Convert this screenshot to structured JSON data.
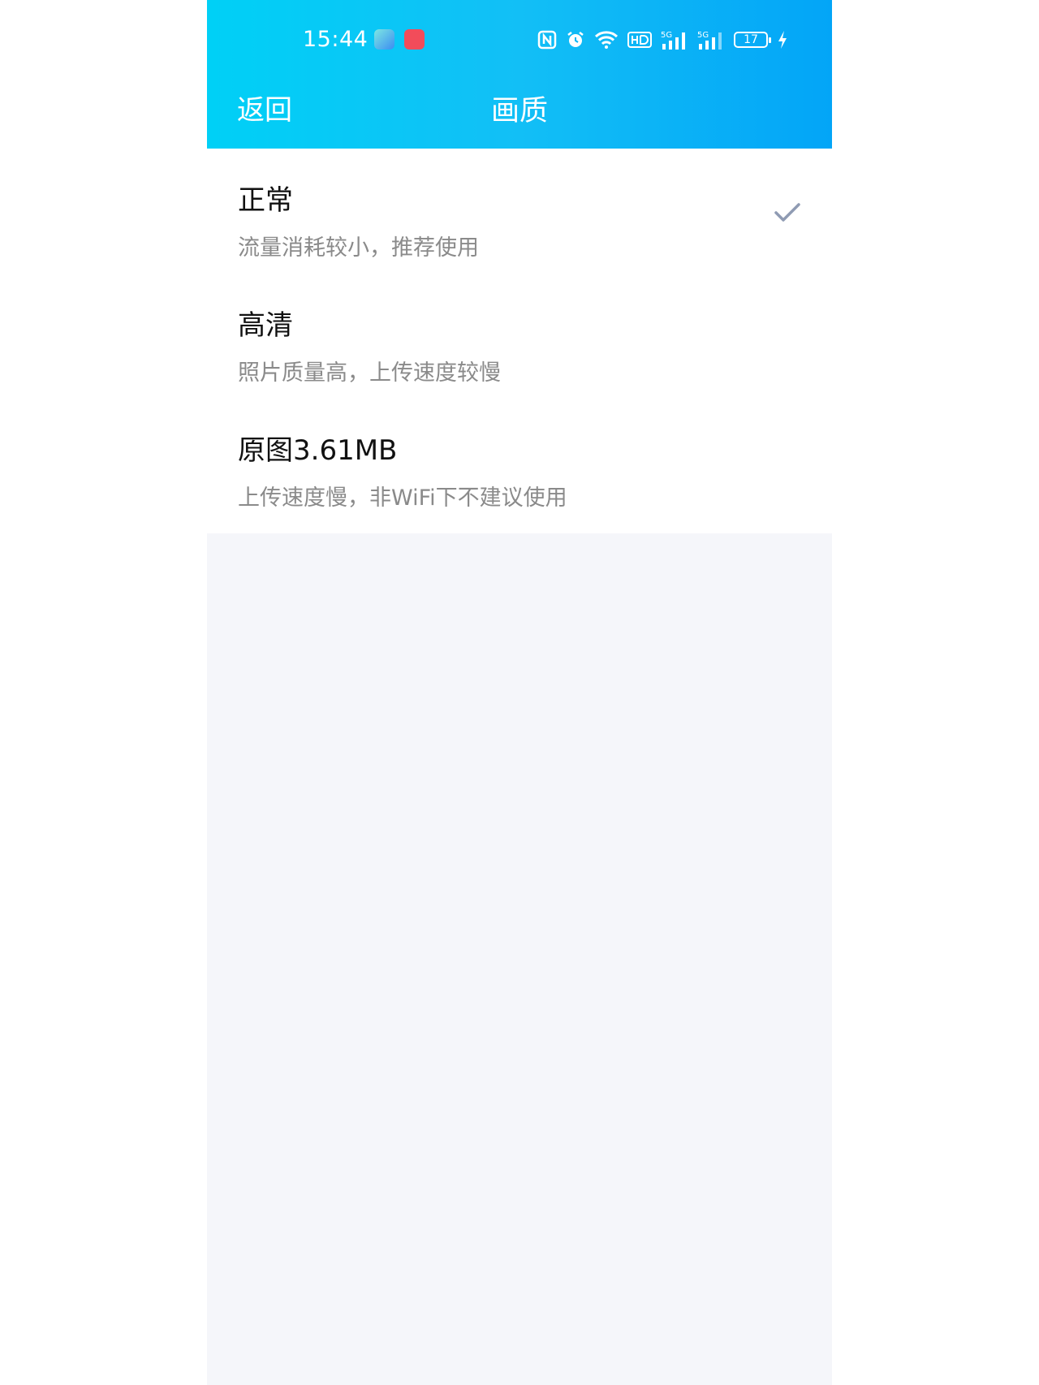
{
  "status_bar": {
    "time": "15:44",
    "battery_level": "17"
  },
  "header": {
    "back_label": "返回",
    "title": "画质"
  },
  "options": [
    {
      "title": "正常",
      "description": "流量消耗较小，推荐使用",
      "selected": true
    },
    {
      "title": "高清",
      "description": "照片质量高，上传速度较慢",
      "selected": false
    },
    {
      "title": "原图3.61MB",
      "description": "上传速度慢，非WiFi下不建议使用",
      "selected": false
    }
  ],
  "colors": {
    "header_gradient_start": "#00d0f6",
    "header_gradient_end": "#03a5f7",
    "check_color": "#8f9bb3",
    "background": "#f5f6fa"
  },
  "icons": {
    "status": [
      "nfc-icon",
      "alarm-icon",
      "wifi-icon",
      "hd-icon",
      "signal-5g-icon",
      "signal-5g-icon",
      "battery-icon",
      "charging-icon"
    ],
    "selected": "check-icon"
  }
}
